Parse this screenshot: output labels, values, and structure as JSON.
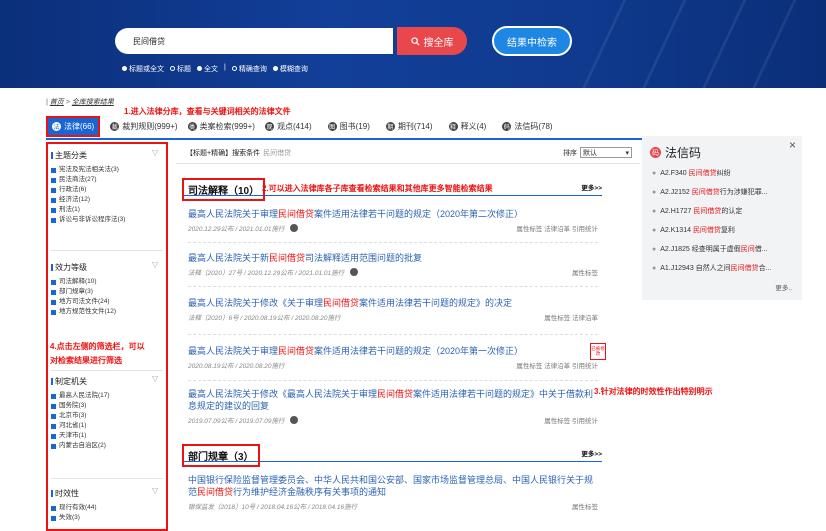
{
  "search": {
    "query": "民间借贷",
    "search_all_label": "搜全库",
    "search_in_results_label": "结果中检索",
    "options": [
      {
        "label": "标题或全文",
        "checked": true
      },
      {
        "label": "标题",
        "checked": false
      },
      {
        "label": "全文",
        "checked": true
      },
      {
        "label": "精确查询",
        "checked": false
      },
      {
        "label": "模糊查询",
        "checked": true
      }
    ],
    "divider": "|"
  },
  "breadcrumb": {
    "home": "首页",
    "sep": ">",
    "current": "全库搜索结果"
  },
  "annotations": {
    "a1": "1.进入法律分库，查看与关键词相关的法律文件",
    "a2": "2.可以进入法律库各子库查看检索结果和其他库更多智能检索结果",
    "a3": "3.针对法律的时效性作出特别明示",
    "a4_line1": "4.点击左侧的筛选栏，可以",
    "a4_line2": "对检索结果进行筛选"
  },
  "tabs": [
    {
      "icon": "法",
      "label": "法律(66)"
    },
    {
      "icon": "裁",
      "label": "裁判规则(999+)"
    },
    {
      "icon": "类",
      "label": "类案检索(999+)"
    },
    {
      "icon": "观",
      "label": "观点(414)"
    },
    {
      "icon": "图",
      "label": "图书(19)"
    },
    {
      "icon": "期",
      "label": "期刊(714)"
    },
    {
      "icon": "释",
      "label": "释义(4)"
    },
    {
      "icon": "码",
      "label": "法信码(78)"
    }
  ],
  "sidebar": {
    "groups": [
      {
        "title": "主题分类",
        "items": [
          "宪法及宪法相关法(3)",
          "民法商法(27)",
          "行政法(6)",
          "经济法(12)",
          "刑法(1)",
          "诉讼与非诉讼程序法(3)"
        ]
      },
      {
        "title": "效力等级",
        "items": [
          "司法解释(10)",
          "部门规章(3)",
          "地方司法文件(24)",
          "地方规范性文件(12)"
        ]
      },
      {
        "title": "制定机关",
        "items": [
          "最高人民法院(17)",
          "国务院(3)",
          "北京市(3)",
          "河北省(1)",
          "天津市(1)",
          "内蒙古自治区(2)"
        ]
      },
      {
        "title": "时效性",
        "items": [
          "现行有效(44)",
          "失效(3)"
        ]
      }
    ]
  },
  "main": {
    "condition_label": "【标题+精确】搜索条件",
    "condition_keyword": "民间借贷",
    "sort_label": "排序",
    "sort_value": "默认",
    "sections": [
      {
        "title": "司法解释（10）",
        "more": "更多>>"
      },
      {
        "title": "部门规章（3）",
        "more": "更多>>"
      }
    ],
    "items": [
      {
        "pre": "最高人民法院关于审理",
        "kw": "民间借贷",
        "post": "案件适用法律若干问题的规定（2020年第二次修正）",
        "meta": "2020.12.29公布 / 2021.01.01施行",
        "tags": "属性标签   法律沿革   引用统计"
      },
      {
        "pre": "最高人民法院关于新",
        "kw": "民间借贷",
        "post": "司法解释适用范围问题的批复",
        "meta": "法释〔2020〕27号 / 2020.12.29公布 / 2021.01.01施行",
        "tags": "属性标签"
      },
      {
        "pre": "最高人民法院关于修改《关于审理",
        "kw": "民间借贷",
        "post": "案件适用法律若干问题的规定》的决定",
        "meta": "法释〔2020〕6号 / 2020.08.19公布 / 2020.08.20施行",
        "tags": "属性标签   法律沿革"
      },
      {
        "pre": "最高人民法院关于审理",
        "kw": "民间借贷",
        "post": "案件适用法律若干问题的规定（2020年第一次修正）",
        "meta": "2020.08.19公布 / 2020.08.20施行",
        "tags": "属性标签   法律沿革   引用统计"
      },
      {
        "pre": "最高人民法院关于修改《最高人民法院关于审理",
        "kw": "民间借贷",
        "post": "案件适用法律若干问题的规定》中关于借款利息规定的建议的回复",
        "meta": "2019.07.09公布 / 2019.07.09施行",
        "tags": "属性标签   引用统计"
      },
      {
        "pre": "中国银行保险监督管理委员会、中华人民共和国公安部、国家市场监督管理总局、中国人民银行关于规范",
        "kw": "民间借贷",
        "post": "行为维护经济金融秩序有关事项的通知",
        "meta": "银保监发〔2018〕10号 / 2018.04.16公布 / 2018.04.16施行",
        "tags": "属性标签"
      }
    ],
    "stamp_text": "已被修改"
  },
  "fa_panel": {
    "title": "法信码",
    "close": "×",
    "more": "更多..",
    "items": [
      {
        "code": "A2.F340",
        "pre": "",
        "kw": "民间借贷",
        "post": "纠纷"
      },
      {
        "code": "A2.J2152",
        "pre": "",
        "kw": "民间借贷",
        "post": "行为涉嫌犯罪..."
      },
      {
        "code": "A2.H1727",
        "pre": "",
        "kw": "民间借贷",
        "post": "的认定"
      },
      {
        "code": "A2.K1314",
        "pre": "",
        "kw": "民间借贷",
        "post": "复利"
      },
      {
        "code": "A2.J1825",
        "pre": "经查明属于虚假",
        "kw": "民间",
        "post": "借..."
      },
      {
        "code": "A1.J12943",
        "pre": "自然人之间",
        "kw": "民间借贷",
        "post": "合..."
      }
    ]
  },
  "colors": {
    "accent": "#1866d6",
    "danger": "#e11111",
    "header": "#123f99",
    "search_btn": "#e8484b",
    "result_btn": "#1e86e3"
  }
}
